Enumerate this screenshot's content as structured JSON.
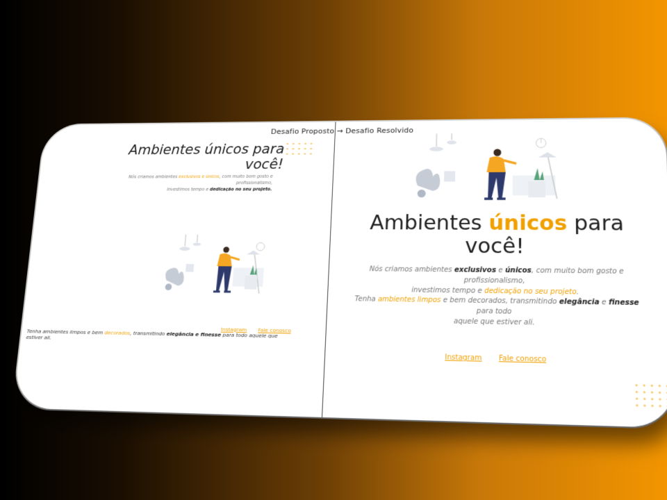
{
  "header": {
    "breadcrumb_from": "Desafio Proposto",
    "breadcrumb_arrow": "→",
    "breadcrumb_to": "Desafio Resolvido"
  },
  "left": {
    "title": "Ambientes únicos para você!",
    "desc": {
      "t1": "Nós criamos ambientes ",
      "h1": "exclusivos e únicos",
      "t2": ", com muito bom gosto e profissionalismo,",
      "t3": "investimos tempo e ",
      "b1": "dedicação no seu projeto.",
      "t4": ""
    },
    "bottom": {
      "t1": "Tenha ambientes limpos e bem ",
      "h1": "decorados",
      "t2": ", transmitindo ",
      "b1": "elegância e finesse",
      "t3": " para todo aquele que estiver ali."
    },
    "links": {
      "instagram": "Instagram",
      "contact": "Fale conosco"
    }
  },
  "right": {
    "title_pre": "Ambientes ",
    "title_hl": "únicos",
    "title_post": " para você!",
    "p1": {
      "t1": "Nós criamos ambientes ",
      "b1": "exclusivos",
      "t2": " e ",
      "b2": "únicos",
      "t3": ", com muito bom gosto e profissionalismo,",
      "t4": "investimos tempo e ",
      "h1": "dedicação no seu projeto",
      "t5": "."
    },
    "p2": {
      "t1": "Tenha ",
      "h1": "ambientes limpos",
      "t2": " e bem decorados, transmitindo ",
      "b1": "elegância",
      "t3": " e ",
      "b2": "finesse",
      "t4": " para todo",
      "t5": "aquele que estiver ali."
    },
    "links": {
      "instagram": "Instagram",
      "contact": "Fale conosco"
    }
  },
  "colors": {
    "accent": "#f0a000",
    "person_shirt": "#f5a623",
    "person_pants": "#2d3a6b"
  }
}
